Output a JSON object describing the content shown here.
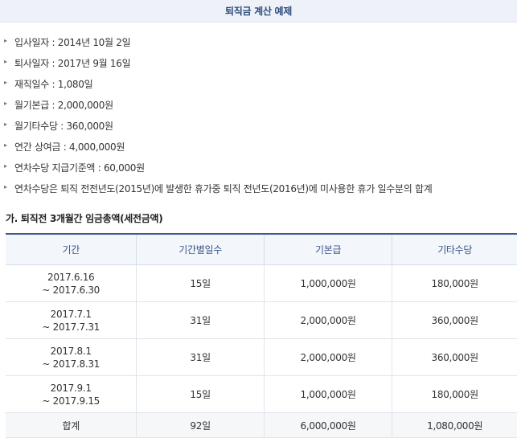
{
  "header": {
    "title": "퇴직금 계산 예제"
  },
  "info": [
    "입사일자 : 2014년 10월 2일",
    "퇴사일자 : 2017년 9월 16일",
    "재직일수 : 1,080일",
    "월기본급 : 2,000,000원",
    "월기타수당 : 360,000원",
    "연간 상여금 : 4,000,000원",
    "연차수당 지급기준액 : 60,000원",
    "연차수당은 퇴직 전전년도(2015년)에 발생한 휴가중 퇴직 전년도(2016년)에 미사용한 휴가 일수분의 합계"
  ],
  "section": {
    "title": "가. 퇴직전 3개월간 임금총액(세전금액)"
  },
  "table": {
    "headers": [
      "기간",
      "기간별일수",
      "기본급",
      "기타수당"
    ],
    "rows": [
      {
        "period_start": "2017.6.16",
        "period_end": "~ 2017.6.30",
        "days": "15일",
        "base": "1,000,000원",
        "extra": "180,000원"
      },
      {
        "period_start": "2017.7.1",
        "period_end": "~ 2017.7.31",
        "days": "31일",
        "base": "2,000,000원",
        "extra": "360,000원"
      },
      {
        "period_start": "2017.8.1",
        "period_end": "~ 2017.8.31",
        "days": "31일",
        "base": "2,000,000원",
        "extra": "360,000원"
      },
      {
        "period_start": "2017.9.1",
        "period_end": "~ 2017.9.15",
        "days": "15일",
        "base": "1,000,000원",
        "extra": "180,000원"
      }
    ],
    "total": {
      "label": "합계",
      "days": "92일",
      "base": "6,000,000원",
      "extra": "1,080,000원"
    }
  }
}
